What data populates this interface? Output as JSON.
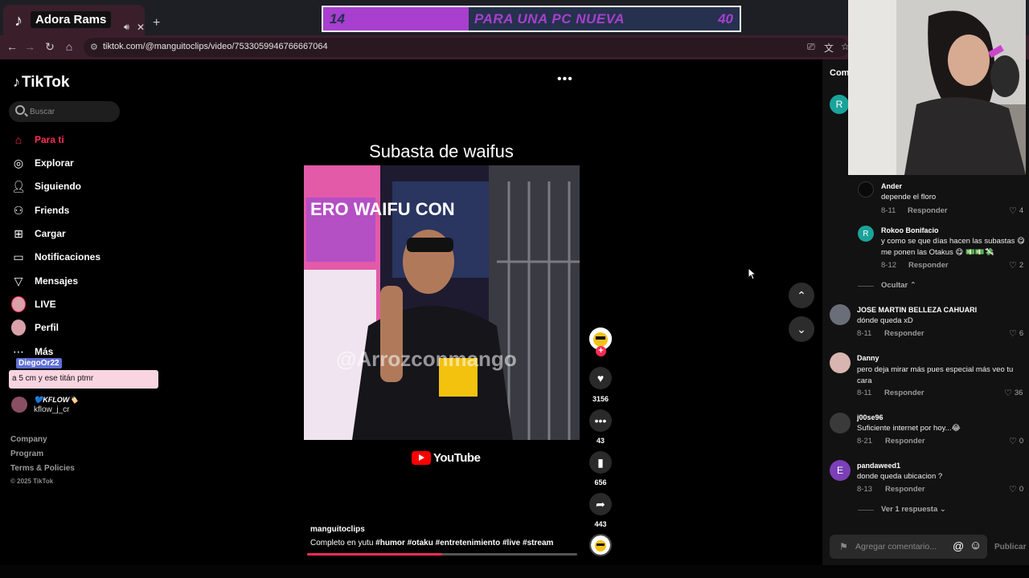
{
  "browser": {
    "tab_title": "Adora Rams",
    "url": "tiktok.com/@manguitoclips/video/7533059946766667064"
  },
  "goal": {
    "current": "14",
    "title": "PARA UNA PC NUEVA",
    "target": "40",
    "fill_fraction": 0.35,
    "colors": {
      "fill": "#a83fcf",
      "track": "#26314e"
    }
  },
  "sidebar": {
    "logo": "TikTok",
    "search_placeholder": "Buscar",
    "items": [
      {
        "label": "Para ti",
        "icon": "home-icon"
      },
      {
        "label": "Explorar",
        "icon": "compass-icon"
      },
      {
        "label": "Siguiendo",
        "icon": "user-plus-icon"
      },
      {
        "label": "Friends",
        "icon": "friends-icon"
      },
      {
        "label": "Cargar",
        "icon": "upload-icon"
      },
      {
        "label": "Notificaciones",
        "icon": "notification-icon"
      },
      {
        "label": "Mensajes",
        "icon": "send-icon"
      },
      {
        "label": "LIVE",
        "icon": "live-icon"
      },
      {
        "label": "Perfil",
        "icon": "profile-icon"
      },
      {
        "label": "Más",
        "icon": "more-icon"
      }
    ],
    "chat_overlay": {
      "user": "DiegoOr22",
      "message": "a 5 cm y ese titán ptmr"
    },
    "following": {
      "name": "💙KFLOW🏷️",
      "handle": "kflow_j_cr"
    },
    "footer": [
      "Company",
      "Program",
      "Terms & Policies"
    ],
    "copyright": "© 2025 TikTok"
  },
  "video": {
    "heading": "Subasta de waifus",
    "watermark": "@Arrozconmango",
    "poster_text": "ERO WAIFU CON",
    "youtube_label": "YouTube",
    "author": "manguitoclips",
    "caption": "Completo en yutu",
    "hashtags": [
      "#humor",
      "#otaku",
      "#entretenimiento",
      "#live",
      "#stream"
    ],
    "progress": 0.5,
    "likes": "3156",
    "comments": "43",
    "saves": "656",
    "shares": "443"
  },
  "comments_panel": {
    "title": "Com",
    "comments": [
      {
        "name": "Ander",
        "text": "depende el floro",
        "date": "8-11",
        "likes": "4"
      },
      {
        "name": "Rokoo Bonifacio",
        "text": "y como se que días hacen las subastas 😋 me ponen las Otakus 😋 💵💵💸",
        "date": "8-12",
        "likes": "2"
      },
      {
        "name": "JOSE MARTIN BELLEZA CAHUARI",
        "text": "dónde queda xD",
        "date": "8-11",
        "likes": "6"
      },
      {
        "name": "Danny",
        "text": "pero deja mirar más pues especial más veo tu cara",
        "date": "8-11",
        "likes": "36"
      },
      {
        "name": "j00se96",
        "text": "Suficiente internet por hoy...😂",
        "date": "8-21",
        "likes": "0"
      },
      {
        "name": "pandaweed1",
        "text": "donde queda ubicacion ?",
        "date": "8-13",
        "likes": "0"
      }
    ],
    "reply_label": "Responder",
    "hide_label": "Ocultar",
    "view_replies_label": "Ver 1 respuesta",
    "input_placeholder": "Agregar comentario...",
    "publish_label": "Publicar",
    "avatar_letters": {
      "top": "R",
      "rokoo": "R",
      "panda": "E"
    }
  }
}
